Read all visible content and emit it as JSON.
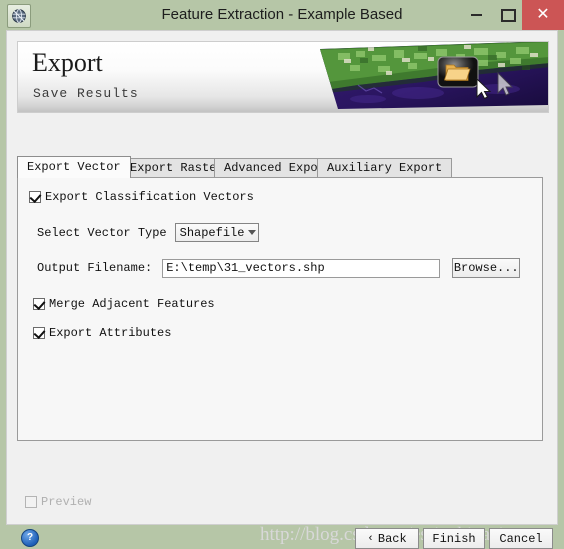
{
  "window": {
    "title": "Feature Extraction - Example Based",
    "app_icon": "envi-globe-icon",
    "controls": {
      "minimize": "minimize-button",
      "maximize": "maximize-button",
      "close_glyph": "✕"
    },
    "colors": {
      "titlebar": "#b6c6a7",
      "close_button": "#cc5555",
      "client_background": "#f0f0f0",
      "panel_background": "#f7f7f7"
    }
  },
  "banner": {
    "title": "Export",
    "subtitle": "Save Results",
    "image_alt": "satellite-aerial-imagery",
    "overlay_icon": "folder-icon",
    "cursor_icon": "mouse-pointer-icon"
  },
  "tabs": [
    {
      "label": "Export Vector",
      "active": true
    },
    {
      "label": "Export Raster",
      "active": false
    },
    {
      "label": "Advanced Export",
      "active": false
    },
    {
      "label": "Auxiliary Export",
      "active": false
    }
  ],
  "form": {
    "export_classification_vectors": {
      "label": "Export Classification Vectors",
      "checked": true
    },
    "vector_type": {
      "label": "Select Vector Type",
      "value": "Shapefile",
      "options": [
        "Shapefile"
      ]
    },
    "output_filename": {
      "label": "Output Filename:",
      "value": "E:\\temp\\31_vectors.shp",
      "placeholder": ""
    },
    "browse_button": "Browse...",
    "merge_adjacent_features": {
      "label": "Merge Adjacent Features",
      "checked": true
    },
    "export_attributes": {
      "label": "Export Attributes",
      "checked": true
    }
  },
  "footer": {
    "preview": {
      "label": "Preview",
      "checked": false,
      "disabled": true
    },
    "help_icon": "?",
    "buttons": {
      "back": "Back",
      "back_chevron": "‹",
      "finish": "Finish",
      "cancel": "Cancel"
    }
  },
  "watermark": {
    "text": "http://blog.csdn.net/esri_chinaei"
  }
}
